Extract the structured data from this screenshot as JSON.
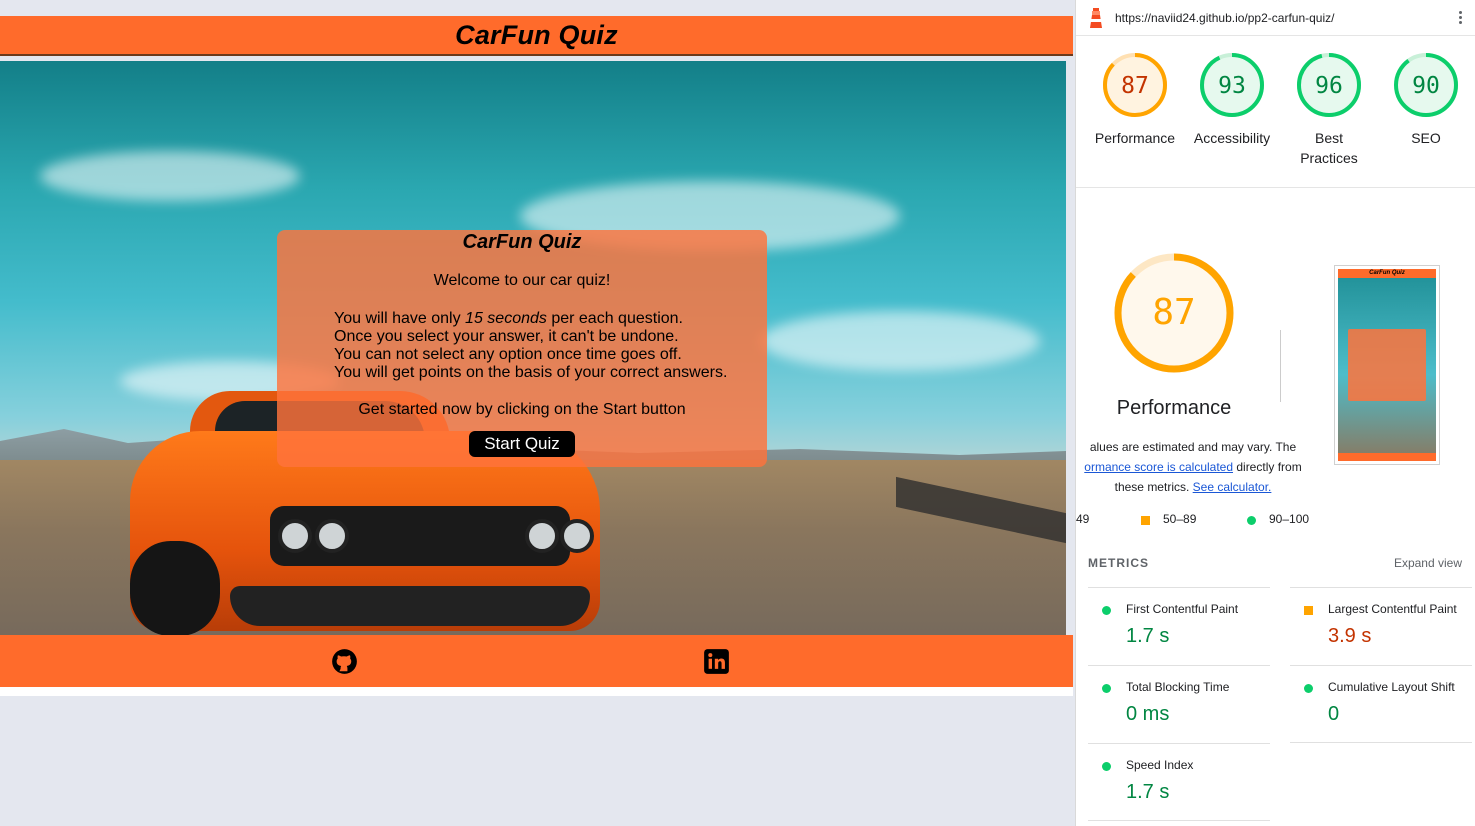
{
  "site": {
    "header_title": "CarFun Quiz",
    "modal": {
      "title": "CarFun Quiz",
      "welcome": "Welcome to our car quiz!",
      "rule1_pre": "You will have only ",
      "rule1_em": "15 seconds",
      "rule1_post": " per each question.",
      "rule2": "Once you select your answer, it can't be undone.",
      "rule3": "You can not select any option once time goes off.",
      "rule4": "You will get points on the basis of your correct answers.",
      "get_started": "Get started now by clicking on the Start button",
      "start_button": "Start Quiz"
    },
    "footer_icons": [
      "github-icon",
      "linkedin-icon"
    ]
  },
  "lighthouse": {
    "url": "https://naviid24.github.io/pp2-carfun-quiz/",
    "gauges": [
      {
        "label": "Performance",
        "score": "87",
        "status": "average"
      },
      {
        "label": "Accessibility",
        "score": "93",
        "status": "pass"
      },
      {
        "label": "Best Practices",
        "score": "96",
        "status": "pass"
      },
      {
        "label": "SEO",
        "score": "90",
        "status": "pass"
      }
    ],
    "main_score": "87",
    "main_label": "Performance",
    "thumb_title": "CarFun Quiz",
    "note_line1": "alues are estimated and may vary. The",
    "note_link1": "ormance score is calculated",
    "note_line2_post": " directly from",
    "note_line3_pre": "these metrics. ",
    "note_link2": "See calculator.",
    "legend": {
      "fail": "49",
      "average": "50–89",
      "pass": "90–100"
    },
    "metrics_title": "METRICS",
    "expand_view": "Expand view",
    "metrics": [
      {
        "name": "First Contentful Paint",
        "value": "1.7 s",
        "status": "pass"
      },
      {
        "name": "Largest Contentful Paint",
        "value": "3.9 s",
        "status": "fail"
      },
      {
        "name": "Total Blocking Time",
        "value": "0 ms",
        "status": "pass"
      },
      {
        "name": "Cumulative Layout Shift",
        "value": "0",
        "status": "pass"
      },
      {
        "name": "Speed Index",
        "value": "1.7 s",
        "status": "pass"
      }
    ],
    "colors": {
      "orange": "#ffa400",
      "green": "#0cce6b",
      "red": "#c33300",
      "brand": "#ff6b2b"
    }
  }
}
